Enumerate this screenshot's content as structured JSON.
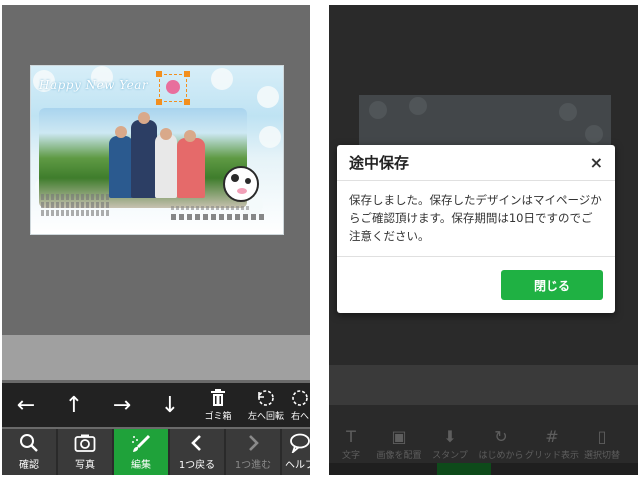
{
  "editor": {
    "card": {
      "greeting_title": "Happy New Year"
    },
    "arrow_toolbar": {
      "left_arrow": "←",
      "up_arrow": "↑",
      "right_arrow": "→",
      "down_arrow": "↓",
      "trash_label": "ゴミ箱",
      "rotate_left_label": "左へ回転",
      "rotate_right_label": "右へ"
    },
    "bottom_toolbar": {
      "items": [
        {
          "label": "確認",
          "icon": "search-icon"
        },
        {
          "label": "写真",
          "icon": "camera-icon"
        },
        {
          "label": "編集",
          "icon": "brush-icon",
          "active": true
        },
        {
          "label": "1つ戻る",
          "icon": "chevron-left-icon"
        },
        {
          "label": "1つ進む",
          "icon": "chevron-right-icon",
          "disabled": true
        },
        {
          "label": "ヘルプ",
          "icon": "speech-bubble-icon"
        }
      ]
    }
  },
  "dialog": {
    "title": "途中保存",
    "close_symbol": "×",
    "message": "保存しました。保存したデザインはマイページからご確認頂けます。保存期間は10日ですのでご注意ください。",
    "button_label": "閉じる"
  },
  "dimmed_toolbar": {
    "items": [
      {
        "label": "文字",
        "icon": "T"
      },
      {
        "label": "画像を配置",
        "icon": "image-icon"
      },
      {
        "label": "スタンプ",
        "icon": "stamp-icon"
      },
      {
        "label": "はじめから",
        "icon": "reset-icon"
      },
      {
        "label": "グリッド表示",
        "icon": "grid-icon"
      },
      {
        "label": "選択切替",
        "icon": "select-icon"
      }
    ]
  },
  "colors": {
    "accent_green": "#1fb143",
    "selection_orange": "#f28f1e"
  }
}
